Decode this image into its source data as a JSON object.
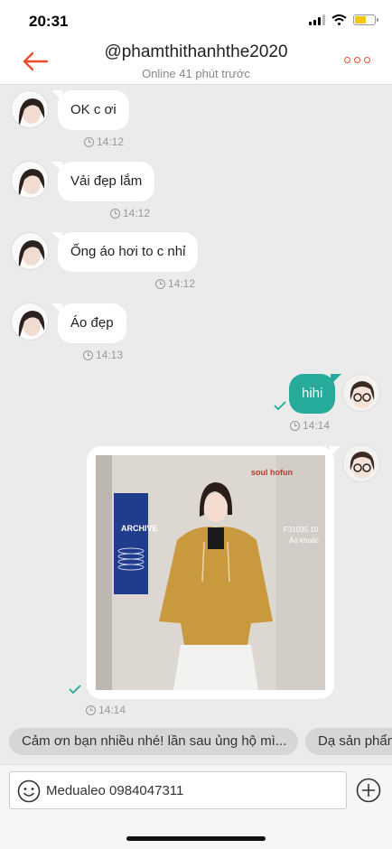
{
  "status_bar": {
    "time": "20:31"
  },
  "header": {
    "title": "@phamthithanhthe2020",
    "subtitle": "Online 41 phút trước",
    "accent": "#ee4d2d"
  },
  "messages": [
    {
      "side": "in",
      "text": "OK c ơi",
      "time": "14:12"
    },
    {
      "side": "in",
      "text": "Vải đẹp lắm",
      "time": "14:12"
    },
    {
      "side": "in",
      "text": "Ống áo hơi to c nhỉ",
      "time": "14:12"
    },
    {
      "side": "in",
      "text": "Áo đẹp",
      "time": "14:13"
    },
    {
      "side": "out",
      "text": "hihi",
      "time": "14:14"
    },
    {
      "side": "out",
      "type": "image",
      "time": "14:14",
      "photo_text": {
        "top_label": "soul hofun",
        "poster": "ARCHIVE",
        "tag": "F31035 10",
        "tag_sub": "Áo khoác"
      }
    }
  ],
  "quick_replies": [
    "Cảm ơn bạn nhiều nhé! lần sau ủng hộ mì...",
    "Dạ sản phẩm"
  ],
  "input": {
    "value": "Medualeo 0984047311"
  },
  "icons": [
    "back-arrow-icon",
    "more-dots-icon",
    "clock-icon",
    "check-icon",
    "emoji-icon",
    "plus-icon"
  ],
  "colors": {
    "sent_bubble": "#26aa99",
    "background": "#ebebeb"
  }
}
